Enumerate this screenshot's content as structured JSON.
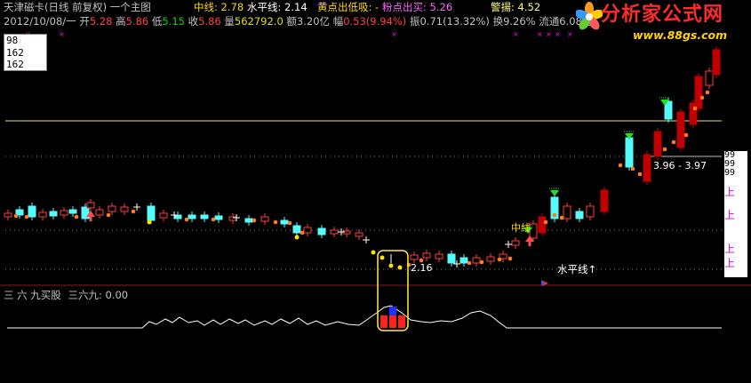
{
  "header": {
    "title": "天津磁卡(日线 前复权) 一个主图",
    "ind1_label": "中线: ",
    "ind1_val": "2.78",
    "ind2_label": "水平线: ",
    "ind2_val": "2.14",
    "ind3_label": "黄点出低吸: ",
    "ind3_val": "-",
    "ind4_label": "粉点出买: ",
    "ind4_val": "5.26",
    "ind5_label": "警揚: ",
    "ind5_val": "4.52"
  },
  "quote": {
    "date": "2012/10/08/一",
    "open_label": "开",
    "open": "5.28",
    "high_label": "高",
    "high": "5.86",
    "low_label": "低",
    "low": "5.15",
    "close_label": "收",
    "close": "5.86",
    "vol_label": "量",
    "vol": "562792.0",
    "amt_label": "额",
    "amt": "3.20亿",
    "chg_label": "幅",
    "chg": "0.53(9.94%)",
    "amp_label": "振",
    "amp": "0.71(13.32%)",
    "turn_label": "换",
    "turn": "9.26%",
    "float_label": "流通",
    "float": "6.08亿"
  },
  "y_axis": [
    "98",
    "162",
    "162"
  ],
  "right_axis": {
    "labels": [
      "99",
      "99",
      "99"
    ],
    "markers": [
      "上",
      "上",
      "上",
      "上"
    ]
  },
  "annotations": {
    "range": "3.96 - 3.97",
    "low_price": "2.16",
    "zhong": "中线",
    "shuiping": "水平线↑"
  },
  "sub_panel": {
    "title": "三 六 九买股",
    "value_label": "三六九: ",
    "value": "0.00"
  },
  "logo": {
    "name": "分析家公式网",
    "url": "www.88gs.com"
  },
  "colors": {
    "up": "#ff3c3c",
    "down": "#54fcfc",
    "big_up": "#c00000",
    "yellow_dot": "#ffe000",
    "orange_dot": "#ff7a28",
    "green_arrow": "#22e022",
    "h_line": "#e8e088",
    "magenta": "#ff00ff"
  }
}
